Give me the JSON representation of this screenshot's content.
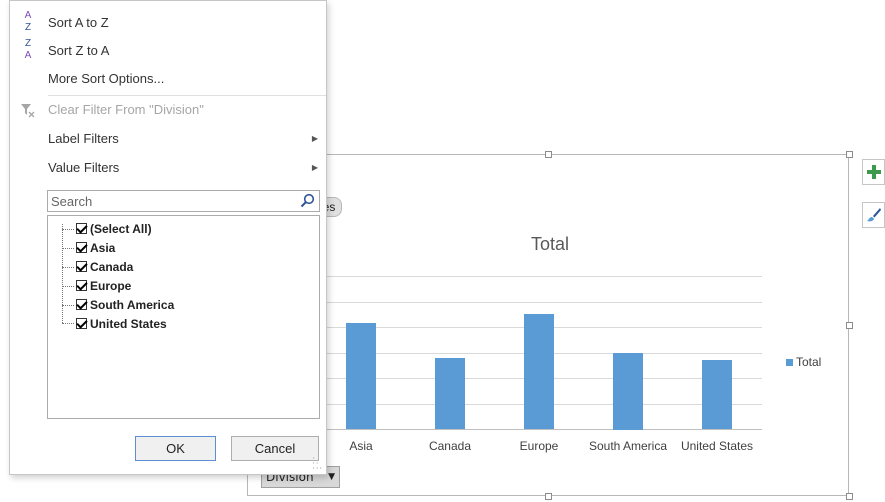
{
  "menu": {
    "sort_az": "Sort A to Z",
    "sort_za": "Sort Z to A",
    "more_sort": "More Sort Options...",
    "clear_filter": "Clear Filter From \"Division\"",
    "label_filters": "Label Filters",
    "value_filters": "Value Filters"
  },
  "search": {
    "placeholder": "Search"
  },
  "filter_list": {
    "select_all": "(Select All)",
    "items": [
      "Asia",
      "Canada",
      "Europe",
      "South America",
      "United States"
    ],
    "checked": [
      true,
      true,
      true,
      true,
      true,
      true
    ]
  },
  "buttons": {
    "ok": "OK",
    "cancel": "Cancel"
  },
  "chart_area": {
    "values_tag": "les",
    "field_button": "Division"
  },
  "icons": {
    "sort_az": "sort-ascending-icon",
    "sort_za": "sort-descending-icon",
    "clear_filter": "clear-filter-icon",
    "search": "search-icon",
    "chart_elements": "plus-icon",
    "chart_styles": "brush-icon"
  },
  "colors": {
    "bar": "#5b9bd5",
    "accent_plus": "#3c9a4a"
  },
  "chart_data": {
    "type": "bar",
    "title": "Total",
    "categories": [
      "Asia",
      "Canada",
      "Europe",
      "South America",
      "United States"
    ],
    "series": [
      {
        "name": "Total",
        "values": [
          4.5,
          3.0,
          4.9,
          3.25,
          2.95
        ]
      }
    ],
    "ylim": [
      0,
      6.5
    ],
    "grid": true,
    "legend": "right"
  }
}
